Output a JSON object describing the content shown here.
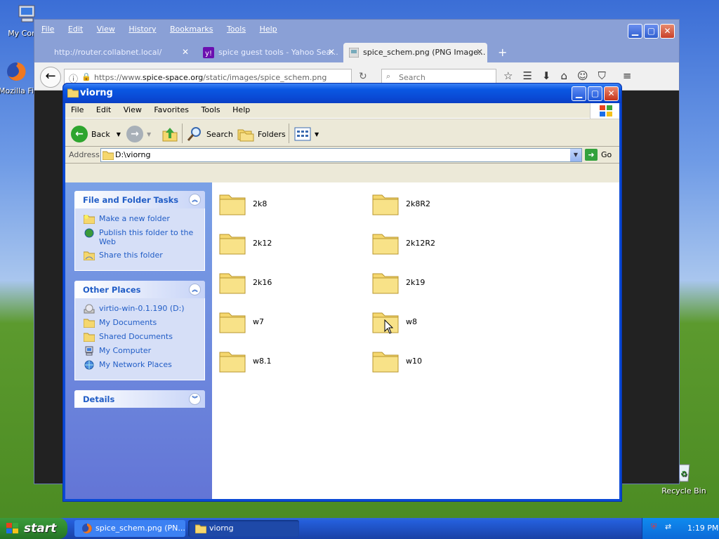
{
  "desktop": {
    "icons": [
      {
        "label": "My Comp"
      },
      {
        "label": "Mozilla Fi"
      },
      {
        "label": "Recycle Bin"
      }
    ]
  },
  "firefox": {
    "menu": [
      "File",
      "Edit",
      "View",
      "History",
      "Bookmarks",
      "Tools",
      "Help"
    ],
    "tabs": [
      {
        "title": "http://router.collabnet.local/"
      },
      {
        "title": "spice guest tools - Yahoo Sea..."
      },
      {
        "title": "spice_schem.png (PNG Image..."
      }
    ],
    "new_tab": "+",
    "url_prefix": "https://www.",
    "url_domain": "spice-space.org",
    "url_path": "/static/images/spice_schem.png",
    "search_placeholder": "Search"
  },
  "explorer": {
    "title": "viorng",
    "menu": [
      "File",
      "Edit",
      "View",
      "Favorites",
      "Tools",
      "Help"
    ],
    "toolbar": {
      "back": "Back",
      "search": "Search",
      "folders": "Folders"
    },
    "address_label": "Address",
    "address_value": "D:\\viorng",
    "go_label": "Go",
    "panels": {
      "file_tasks": {
        "title": "File and Folder Tasks",
        "items": [
          "Make a new folder",
          "Publish this folder to the Web",
          "Share this folder"
        ]
      },
      "other_places": {
        "title": "Other Places",
        "items": [
          "virtio-win-0.1.190 (D:)",
          "My Documents",
          "Shared Documents",
          "My Computer",
          "My Network Places"
        ]
      },
      "details": {
        "title": "Details"
      }
    },
    "folders": [
      "2k8",
      "2k8R2",
      "2k12",
      "2k12R2",
      "2k16",
      "2k19",
      "w7",
      "w8",
      "w8.1",
      "w10"
    ]
  },
  "taskbar": {
    "start_label": "start",
    "buttons": [
      "spice_schem.png (PN...",
      "viorng"
    ],
    "clock": "1:19 PM"
  }
}
